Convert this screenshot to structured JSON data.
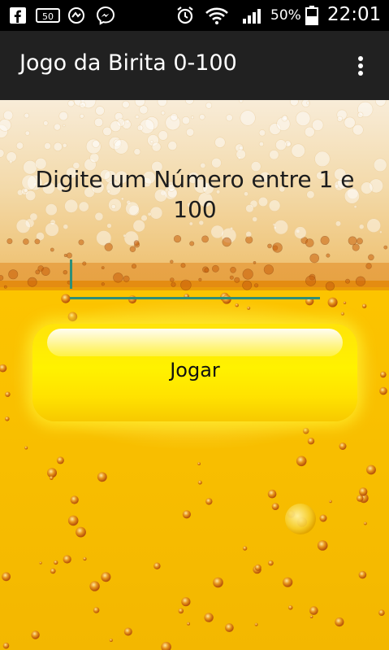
{
  "status_bar": {
    "battery_percent": "50%",
    "time": "22:01",
    "icons": [
      "facebook-icon",
      "hd-50-icon",
      "quick-tool-icon",
      "messenger-icon",
      "alarm-icon",
      "wifi-icon",
      "signal-icon",
      "battery-icon"
    ]
  },
  "action_bar": {
    "title": "Jogo da Birita 0-100",
    "menu_icon": "overflow-menu-icon"
  },
  "main": {
    "prompt": "Digite um Número entre 1 e 100",
    "input_value": "",
    "play_button_label": "Jogar"
  },
  "colors": {
    "action_bar": "#212121",
    "status_bar": "#000000",
    "input_accent": "#2e8f78",
    "button_yellow": "#fff200",
    "beer": "#f5c400",
    "foam": "#f6e3c0"
  }
}
